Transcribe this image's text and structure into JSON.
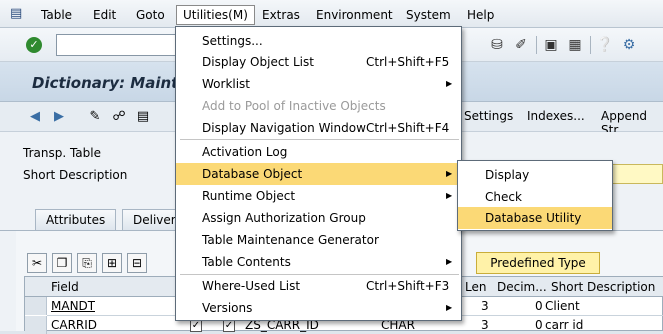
{
  "menubar": {
    "items": [
      "Table",
      "Edit",
      "Goto",
      "Utilities(M)",
      "Extras",
      "Environment",
      "System",
      "Help"
    ]
  },
  "title": "Dictionary: Maint",
  "app_toolbar": {
    "buttons": [
      "Technical Settings",
      "Indexes...",
      "Append Str"
    ]
  },
  "form": {
    "transp_table_label": "Transp. Table",
    "short_description_label": "Short Description"
  },
  "tabs": [
    "Attributes",
    "Delivery"
  ],
  "grid": {
    "predefined_type_button": "Predefined Type",
    "columns": [
      "Field",
      "Length",
      "Decim...",
      "Short Description"
    ],
    "rows": [
      {
        "field": "MANDT",
        "data_element": "",
        "type": "",
        "length": "3",
        "decimals": "0",
        "description": "Client"
      },
      {
        "field": "CARRID",
        "data_element": "ZS_CARR_ID",
        "type": "CHAR",
        "length": "3",
        "decimals": "0",
        "description": "carr id"
      }
    ]
  },
  "utilities_menu": [
    {
      "label": "Settings...",
      "shortcut": "",
      "submenu": false,
      "disabled": false
    },
    {
      "label": "Display Object List",
      "shortcut": "Ctrl+Shift+F5",
      "submenu": false,
      "disabled": false
    },
    {
      "label": "Worklist",
      "shortcut": "",
      "submenu": true,
      "disabled": false
    },
    {
      "label": "Add to Pool of Inactive Objects",
      "shortcut": "",
      "submenu": false,
      "disabled": true
    },
    {
      "label": "Display Navigation Window",
      "shortcut": "Ctrl+Shift+F4",
      "submenu": false,
      "disabled": false
    },
    {
      "label": "Activation Log",
      "shortcut": "",
      "submenu": false,
      "disabled": false
    },
    {
      "label": "Database Object",
      "shortcut": "",
      "submenu": true,
      "disabled": false
    },
    {
      "label": "Runtime Object",
      "shortcut": "",
      "submenu": true,
      "disabled": false
    },
    {
      "label": "Assign Authorization Group",
      "shortcut": "",
      "submenu": false,
      "disabled": false
    },
    {
      "label": "Table Maintenance Generator",
      "shortcut": "",
      "submenu": false,
      "disabled": false
    },
    {
      "label": "Table Contents",
      "shortcut": "",
      "submenu": true,
      "disabled": false
    },
    {
      "label": "Where-Used List",
      "shortcut": "Ctrl+Shift+F3",
      "submenu": false,
      "disabled": false
    },
    {
      "label": "Versions",
      "shortcut": "",
      "submenu": true,
      "disabled": false
    }
  ],
  "database_object_submenu": [
    "Display",
    "Check",
    "Database Utility"
  ],
  "colors": {
    "highlight": "#fbd976",
    "title_band": "#c8d7e6",
    "disabled_text": "#9a9a9a"
  }
}
